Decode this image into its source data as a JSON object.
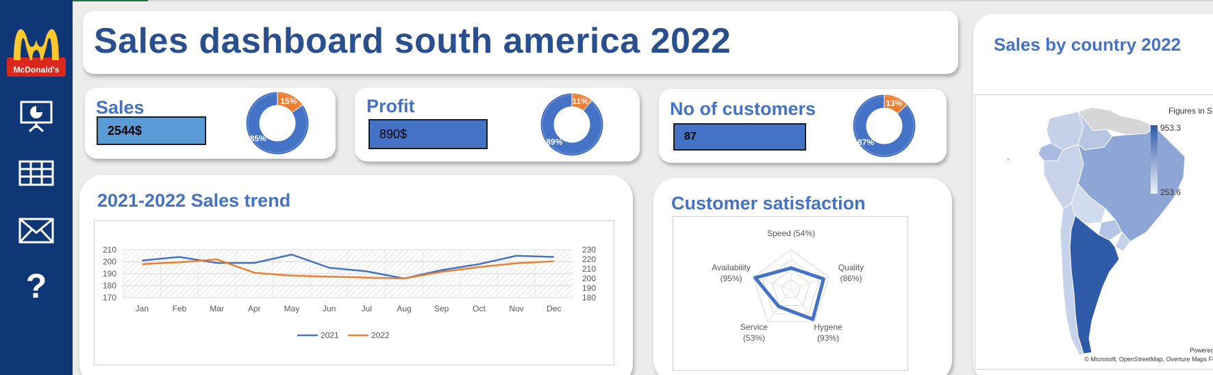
{
  "dashboard": {
    "title": "Sales dashboard south america 2022"
  },
  "sidebar": {
    "logo_text": "McDonald's",
    "items": [
      {
        "name": "presentation-icon"
      },
      {
        "name": "table-icon"
      },
      {
        "name": "mail-icon"
      },
      {
        "name": "help-icon",
        "label": "?"
      }
    ]
  },
  "kpis": [
    {
      "label": "Sales",
      "value": "2544$",
      "donut_primary": "85%",
      "donut_secondary": "15%",
      "primary_pct": 85
    },
    {
      "label": "Profit",
      "value": "890$",
      "donut_primary": "89%",
      "donut_secondary": "11%",
      "primary_pct": 89
    },
    {
      "label": "No of customers",
      "value": "87",
      "donut_primary": "87%",
      "donut_secondary": "13%",
      "primary_pct": 87
    }
  ],
  "colors": {
    "navy": "#0f3775",
    "blue": "#4472c4",
    "orange": "#ed7d31",
    "title": "#2a4f8f",
    "box_light": "#5b9bd5"
  },
  "sales_trend": {
    "title": "2021-2022 Sales trend"
  },
  "satisfaction": {
    "title": "Customer satisfaction"
  },
  "map": {
    "title": "Sales by country 2022",
    "legend_title": "Figures in S",
    "legend_max": "953.3",
    "legend_min": "253.6",
    "powered_by": "Powered b",
    "attribution": "© Microsoft, OpenStreetMap, Overture Maps Fun"
  },
  "chart_data": [
    {
      "type": "line",
      "title": "2021-2022 Sales trend",
      "categories": [
        "Jan",
        "Feb",
        "Mar",
        "Apr",
        "May",
        "Jun",
        "Jul",
        "Aug",
        "Sep",
        "Oct",
        "Nov",
        "Dec"
      ],
      "y_left_ticks": [
        "210",
        "200",
        "190",
        "180",
        "170"
      ],
      "y_right_ticks": [
        "230",
        "220",
        "210",
        "200",
        "190",
        "180"
      ],
      "ylim_left": [
        170,
        210
      ],
      "ylim_right": [
        180,
        230
      ],
      "series": [
        {
          "name": "2021",
          "axis": "left",
          "color": "#4472c4",
          "values": [
            201,
            204,
            199,
            199,
            206,
            195,
            192,
            186,
            193,
            198,
            205,
            204
          ]
        },
        {
          "name": "2022",
          "axis": "right",
          "color": "#ed7d31",
          "values": [
            215,
            217,
            220,
            206,
            203,
            202,
            201,
            200,
            207,
            212,
            216,
            218
          ]
        }
      ],
      "legend": "bottom",
      "grid": true
    },
    {
      "type": "radar",
      "title": "Customer satisfaction",
      "categories": [
        "Speed (54%)",
        "Quality\n(86%)",
        "Hygene\n(93%)",
        "Service\n(53%)",
        "Availability\n(95%)"
      ],
      "values": [
        54,
        86,
        93,
        53,
        95
      ],
      "rmax": 100
    }
  ]
}
